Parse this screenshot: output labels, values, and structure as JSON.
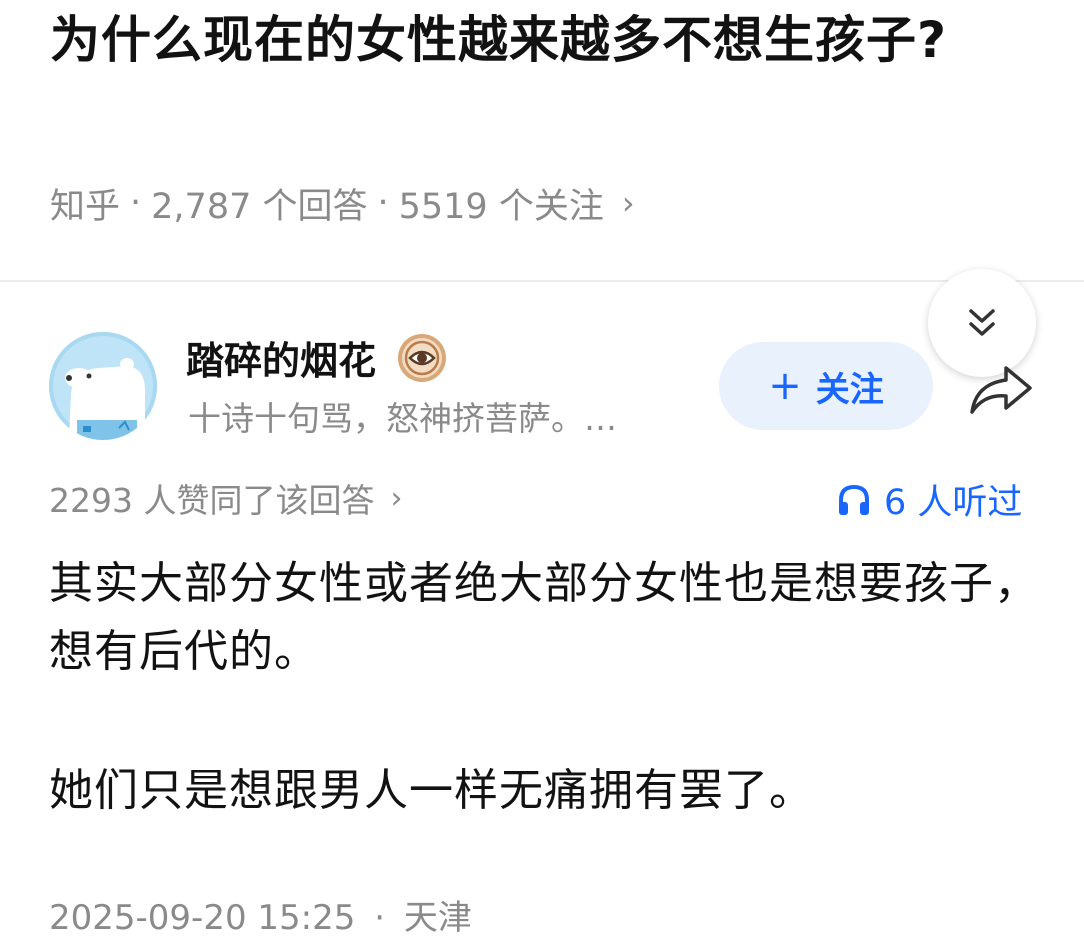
{
  "question": {
    "title": "为什么现在的女性越来越多不想生孩子?",
    "source": "知乎",
    "separator": "·",
    "answer_count": "2,787 个回答",
    "follower_count": "5519 个关注",
    "chevron": "›"
  },
  "author": {
    "name": "踏碎的烟花",
    "bio": "十诗十句骂，怒神挤菩萨。…",
    "badge_icon": "eye-badge-icon",
    "avatar_icon": "polar-bear-avatar"
  },
  "follow_button": {
    "plus": "+",
    "label": "关注"
  },
  "answer": {
    "upvote_text": "2293 人赞同了该回答",
    "chevron": "›",
    "listen_text": "6 人听过",
    "paragraphs": [
      "其实大部分女性或者绝大部分女性也是想要孩子，想有后代的。",
      "她们只是想跟男人一样无痛拥有罢了。"
    ],
    "timestamp": "2025-09-20 15:25",
    "separator": "·",
    "location": "天津"
  },
  "colors": {
    "accent": "#1966ff",
    "follow_bg": "#e9f1fd",
    "meta_text": "#8a8a8a",
    "body_text": "#121212"
  }
}
